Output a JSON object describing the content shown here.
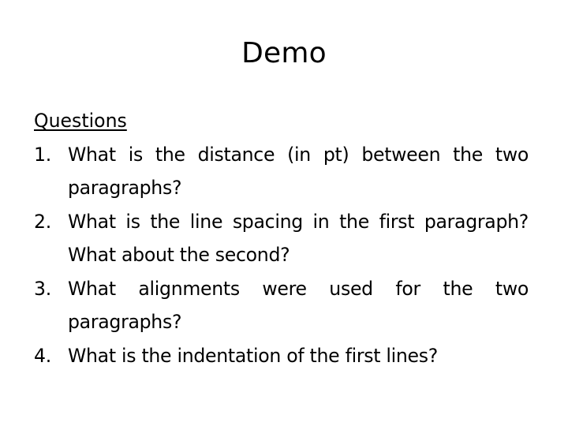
{
  "slide": {
    "title": "Demo",
    "heading": "Questions",
    "questions": [
      {
        "number": "1.",
        "text": "What is the distance (in pt) between the two paragraphs?"
      },
      {
        "number": "2.",
        "text": "What is the line spacing in the first paragraph? What about the second?"
      },
      {
        "number": "3.",
        "text": "What alignments were used for the two paragraphs?"
      },
      {
        "number": "4.",
        "text": "What is the indentation of the first lines?"
      }
    ]
  }
}
